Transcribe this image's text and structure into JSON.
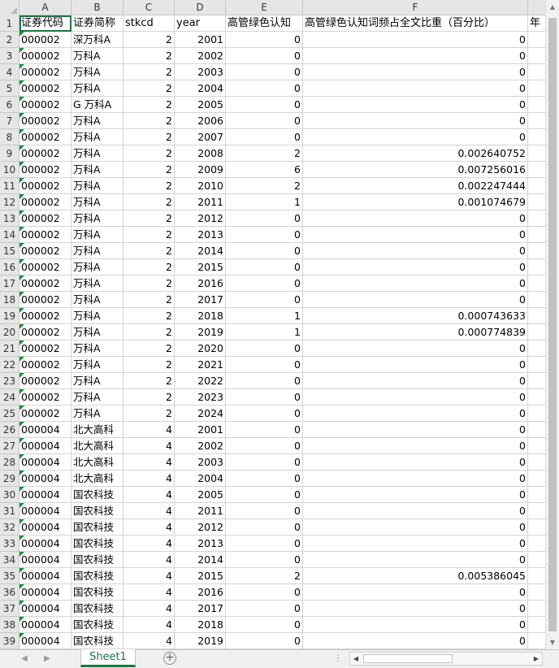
{
  "columns": [
    "A",
    "B",
    "C",
    "D",
    "E",
    "F"
  ],
  "header_row": {
    "row_num": "1",
    "a": "证券代码",
    "b": "证券简称",
    "c": "stkcd",
    "d": "year",
    "e": "高管绿色认知",
    "f": "高管绿色认知词频占全文比重（百分比）",
    "g": "年"
  },
  "rows": [
    {
      "n": "2",
      "code": "000002",
      "name": "深万科A",
      "stkcd": "2",
      "year": "2001",
      "e": "0",
      "f": "0"
    },
    {
      "n": "3",
      "code": "000002",
      "name": "万科A",
      "stkcd": "2",
      "year": "2002",
      "e": "0",
      "f": "0"
    },
    {
      "n": "4",
      "code": "000002",
      "name": "万科A",
      "stkcd": "2",
      "year": "2003",
      "e": "0",
      "f": "0"
    },
    {
      "n": "5",
      "code": "000002",
      "name": "万科A",
      "stkcd": "2",
      "year": "2004",
      "e": "0",
      "f": "0"
    },
    {
      "n": "6",
      "code": "000002",
      "name": "G 万科A",
      "stkcd": "2",
      "year": "2005",
      "e": "0",
      "f": "0"
    },
    {
      "n": "7",
      "code": "000002",
      "name": "万科A",
      "stkcd": "2",
      "year": "2006",
      "e": "0",
      "f": "0"
    },
    {
      "n": "8",
      "code": "000002",
      "name": "万科A",
      "stkcd": "2",
      "year": "2007",
      "e": "0",
      "f": "0"
    },
    {
      "n": "9",
      "code": "000002",
      "name": "万科A",
      "stkcd": "2",
      "year": "2008",
      "e": "2",
      "f": "0.002640752"
    },
    {
      "n": "10",
      "code": "000002",
      "name": "万科A",
      "stkcd": "2",
      "year": "2009",
      "e": "6",
      "f": "0.007256016"
    },
    {
      "n": "11",
      "code": "000002",
      "name": "万科A",
      "stkcd": "2",
      "year": "2010",
      "e": "2",
      "f": "0.002247444"
    },
    {
      "n": "12",
      "code": "000002",
      "name": "万科A",
      "stkcd": "2",
      "year": "2011",
      "e": "1",
      "f": "0.001074679"
    },
    {
      "n": "13",
      "code": "000002",
      "name": "万科A",
      "stkcd": "2",
      "year": "2012",
      "e": "0",
      "f": "0"
    },
    {
      "n": "14",
      "code": "000002",
      "name": "万科A",
      "stkcd": "2",
      "year": "2013",
      "e": "0",
      "f": "0"
    },
    {
      "n": "15",
      "code": "000002",
      "name": "万科A",
      "stkcd": "2",
      "year": "2014",
      "e": "0",
      "f": "0"
    },
    {
      "n": "16",
      "code": "000002",
      "name": "万科A",
      "stkcd": "2",
      "year": "2015",
      "e": "0",
      "f": "0"
    },
    {
      "n": "17",
      "code": "000002",
      "name": "万科A",
      "stkcd": "2",
      "year": "2016",
      "e": "0",
      "f": "0"
    },
    {
      "n": "18",
      "code": "000002",
      "name": "万科A",
      "stkcd": "2",
      "year": "2017",
      "e": "0",
      "f": "0"
    },
    {
      "n": "19",
      "code": "000002",
      "name": "万科A",
      "stkcd": "2",
      "year": "2018",
      "e": "1",
      "f": "0.000743633"
    },
    {
      "n": "20",
      "code": "000002",
      "name": "万科A",
      "stkcd": "2",
      "year": "2019",
      "e": "1",
      "f": "0.000774839"
    },
    {
      "n": "21",
      "code": "000002",
      "name": "万科A",
      "stkcd": "2",
      "year": "2020",
      "e": "0",
      "f": "0"
    },
    {
      "n": "22",
      "code": "000002",
      "name": "万科A",
      "stkcd": "2",
      "year": "2021",
      "e": "0",
      "f": "0"
    },
    {
      "n": "23",
      "code": "000002",
      "name": "万科A",
      "stkcd": "2",
      "year": "2022",
      "e": "0",
      "f": "0"
    },
    {
      "n": "24",
      "code": "000002",
      "name": "万科A",
      "stkcd": "2",
      "year": "2023",
      "e": "0",
      "f": "0"
    },
    {
      "n": "25",
      "code": "000002",
      "name": "万科A",
      "stkcd": "2",
      "year": "2024",
      "e": "0",
      "f": "0"
    },
    {
      "n": "26",
      "code": "000004",
      "name": "北大高科",
      "stkcd": "4",
      "year": "2001",
      "e": "0",
      "f": "0"
    },
    {
      "n": "27",
      "code": "000004",
      "name": "北大高科",
      "stkcd": "4",
      "year": "2002",
      "e": "0",
      "f": "0"
    },
    {
      "n": "28",
      "code": "000004",
      "name": "北大高科",
      "stkcd": "4",
      "year": "2003",
      "e": "0",
      "f": "0"
    },
    {
      "n": "29",
      "code": "000004",
      "name": "北大高科",
      "stkcd": "4",
      "year": "2004",
      "e": "0",
      "f": "0"
    },
    {
      "n": "30",
      "code": "000004",
      "name": "国农科技",
      "stkcd": "4",
      "year": "2005",
      "e": "0",
      "f": "0"
    },
    {
      "n": "31",
      "code": "000004",
      "name": "国农科技",
      "stkcd": "4",
      "year": "2011",
      "e": "0",
      "f": "0"
    },
    {
      "n": "32",
      "code": "000004",
      "name": "国农科技",
      "stkcd": "4",
      "year": "2012",
      "e": "0",
      "f": "0"
    },
    {
      "n": "33",
      "code": "000004",
      "name": "国农科技",
      "stkcd": "4",
      "year": "2013",
      "e": "0",
      "f": "0"
    },
    {
      "n": "34",
      "code": "000004",
      "name": "国农科技",
      "stkcd": "4",
      "year": "2014",
      "e": "0",
      "f": "0"
    },
    {
      "n": "35",
      "code": "000004",
      "name": "国农科技",
      "stkcd": "4",
      "year": "2015",
      "e": "2",
      "f": "0.005386045"
    },
    {
      "n": "36",
      "code": "000004",
      "name": "国农科技",
      "stkcd": "4",
      "year": "2016",
      "e": "0",
      "f": "0"
    },
    {
      "n": "37",
      "code": "000004",
      "name": "国农科技",
      "stkcd": "4",
      "year": "2017",
      "e": "0",
      "f": "0"
    },
    {
      "n": "38",
      "code": "000004",
      "name": "国农科技",
      "stkcd": "4",
      "year": "2018",
      "e": "0",
      "f": "0"
    },
    {
      "n": "39",
      "code": "000004",
      "name": "国农科技",
      "stkcd": "4",
      "year": "2019",
      "e": "0",
      "f": "0"
    }
  ],
  "sheet_tab": "Sheet1",
  "icons": {
    "nav_prev": "chevron-left-icon",
    "nav_next": "chevron-right-icon",
    "add_sheet": "plus-circle-icon",
    "scroll_up": "triangle-up-icon",
    "scroll_down": "triangle-down-icon",
    "scroll_left": "triangle-left-icon",
    "scroll_right": "triangle-right-icon"
  },
  "colors": {
    "accent": "#217346",
    "header_bg": "#e6e6e6",
    "gridline": "#d4d4d4",
    "error_marker": "#1e8c3c"
  }
}
